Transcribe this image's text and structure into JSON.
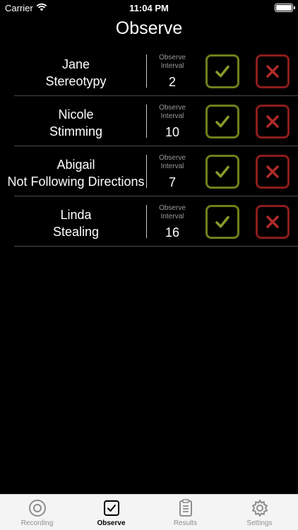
{
  "status_bar": {
    "carrier": "Carrier",
    "time": "11:04 PM",
    "battery_level": 1.0
  },
  "title": "Observe",
  "interval_label_line1": "Observe",
  "interval_label_line2": "Interval",
  "rows": [
    {
      "name": "Jane",
      "behavior": "Stereotypy",
      "interval": "2"
    },
    {
      "name": "Nicole",
      "behavior": "Stimming",
      "interval": "10"
    },
    {
      "name": "Abigail",
      "behavior": "Not Following Directions",
      "interval": "7"
    },
    {
      "name": "Linda",
      "behavior": "Stealing",
      "interval": "16"
    }
  ],
  "tabs": [
    {
      "label": "Recording",
      "icon": "record-icon",
      "active": false
    },
    {
      "label": "Observe",
      "icon": "checkbox-icon",
      "active": true
    },
    {
      "label": "Results",
      "icon": "clipboard-icon",
      "active": false
    },
    {
      "label": "Settings",
      "icon": "gear-icon",
      "active": false
    }
  ],
  "colors": {
    "accept": "#6f7f1b",
    "reject": "#8c1c1c",
    "check_glyph": "#8a9a2a",
    "x_glyph": "#b02a2a"
  }
}
